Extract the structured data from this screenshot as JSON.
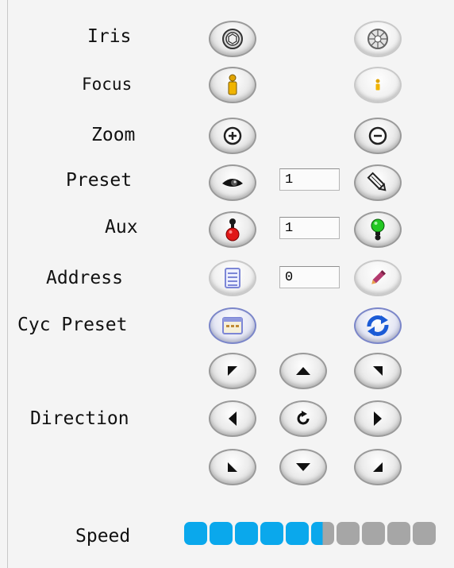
{
  "labels": {
    "iris": "Iris",
    "focus": "Focus",
    "zoom": "Zoom",
    "preset": "Preset",
    "aux": "Aux",
    "address": "Address",
    "cyc_preset": "Cyc Preset",
    "direction": "Direction",
    "speed": "Speed"
  },
  "fields": {
    "preset": "1",
    "aux": "1",
    "address": "0"
  },
  "icons": {
    "iris_open": "iris-open-icon",
    "iris_close": "iris-close-icon",
    "focus_near": "focus-near-icon",
    "focus_far": "focus-far-icon",
    "zoom_in": "zoom-in-icon",
    "zoom_out": "zoom-out-icon",
    "preset_call": "eye-icon",
    "preset_set": "pencil-icon",
    "aux_off": "red-light-icon",
    "aux_on": "green-light-icon",
    "address_list": "list-icon",
    "address_edit": "pen-icon",
    "cyc_preset_window": "window-icon",
    "cyc_preset_cycle": "refresh-icon"
  },
  "speed": {
    "segments": 10,
    "level": 5.5
  },
  "colors": {
    "speed_active": "#0aa8ec",
    "speed_inactive": "#a6a6a6",
    "panel_bg": "#f4f4f4"
  }
}
